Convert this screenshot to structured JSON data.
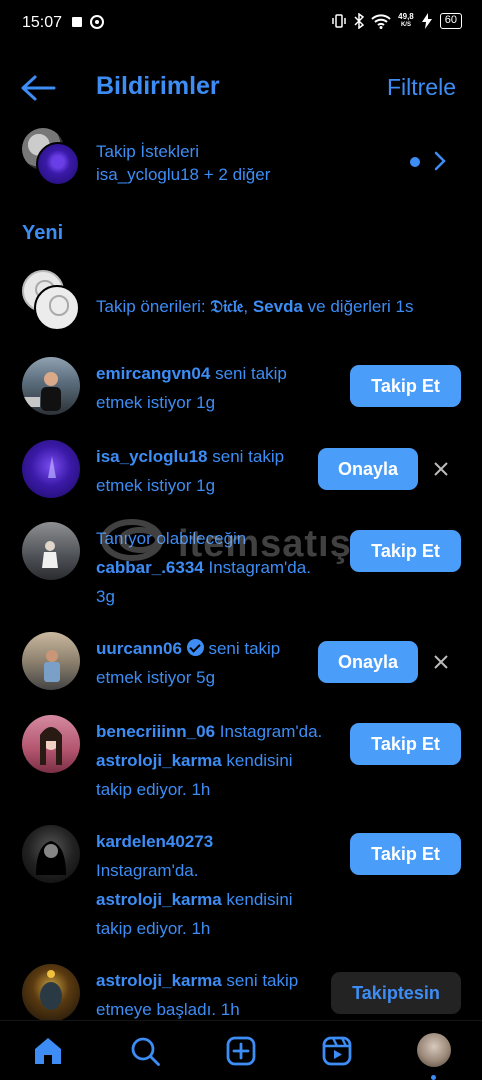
{
  "status_bar": {
    "time": "15:07",
    "network_speed": "49,8",
    "speed_unit": "K/S",
    "battery": "60"
  },
  "header": {
    "title": "Bildirimler",
    "filter_label": "Filtrele"
  },
  "follow_requests": {
    "title": "Takip İstekleri",
    "subtitle": "isa_ycloglu18 + 2 diğer"
  },
  "section_new": "Yeni",
  "suggestions": {
    "prefix": "Takip önerileri: ",
    "name1": "𝔇𝔦𝔠𝔩𝔢",
    "sep": ", ",
    "name2": "Sevda",
    "suffix": " ve diğerleri ",
    "time": "1s"
  },
  "notifications": [
    {
      "username": "emircangvn04",
      "text1": " seni takip",
      "text2": "etmek istiyor ",
      "time": "1g",
      "button": "Takip Et"
    },
    {
      "username": "isa_ycloglu18",
      "text1": " seni takip",
      "text2": "etmek istiyor ",
      "time": "1g",
      "button": "Onayla"
    },
    {
      "line1": "Tanıyor olabileceğin",
      "username": "cabbar_.6334",
      "text1": " Instagram'da.",
      "time": "3g",
      "button": "Takip Et"
    },
    {
      "username": "uurcann06",
      "text1": " seni takip",
      "text2": "etmek istiyor ",
      "time": "5g",
      "button": "Onayla"
    },
    {
      "username": "benecriiinn_06",
      "text1": " Instagram'da.",
      "username2": "astroloji_karma",
      "text2": " kendisini",
      "text3": "takip ediyor. ",
      "time": "1h",
      "button": "Takip Et"
    },
    {
      "username": "kardelen40273",
      "line2": "Instagram'da.",
      "username2": "astroloji_karma",
      "text2": " kendisini",
      "text3": "takip ediyor. ",
      "time": "1h",
      "button": "Takip Et"
    },
    {
      "username": "astroloji_karma",
      "text1": " seni takip",
      "text2": "etmeye başladı. ",
      "time": "1h",
      "button": "Takiptesin"
    }
  ],
  "watermark": "itemsatış",
  "colors": {
    "accent": "#3d8df5",
    "button": "#4a9df8",
    "background": "#000000",
    "button_dark": "#232323"
  },
  "nav": [
    "home-icon",
    "search-icon",
    "create-icon",
    "reels-icon",
    "profile-avatar"
  ]
}
